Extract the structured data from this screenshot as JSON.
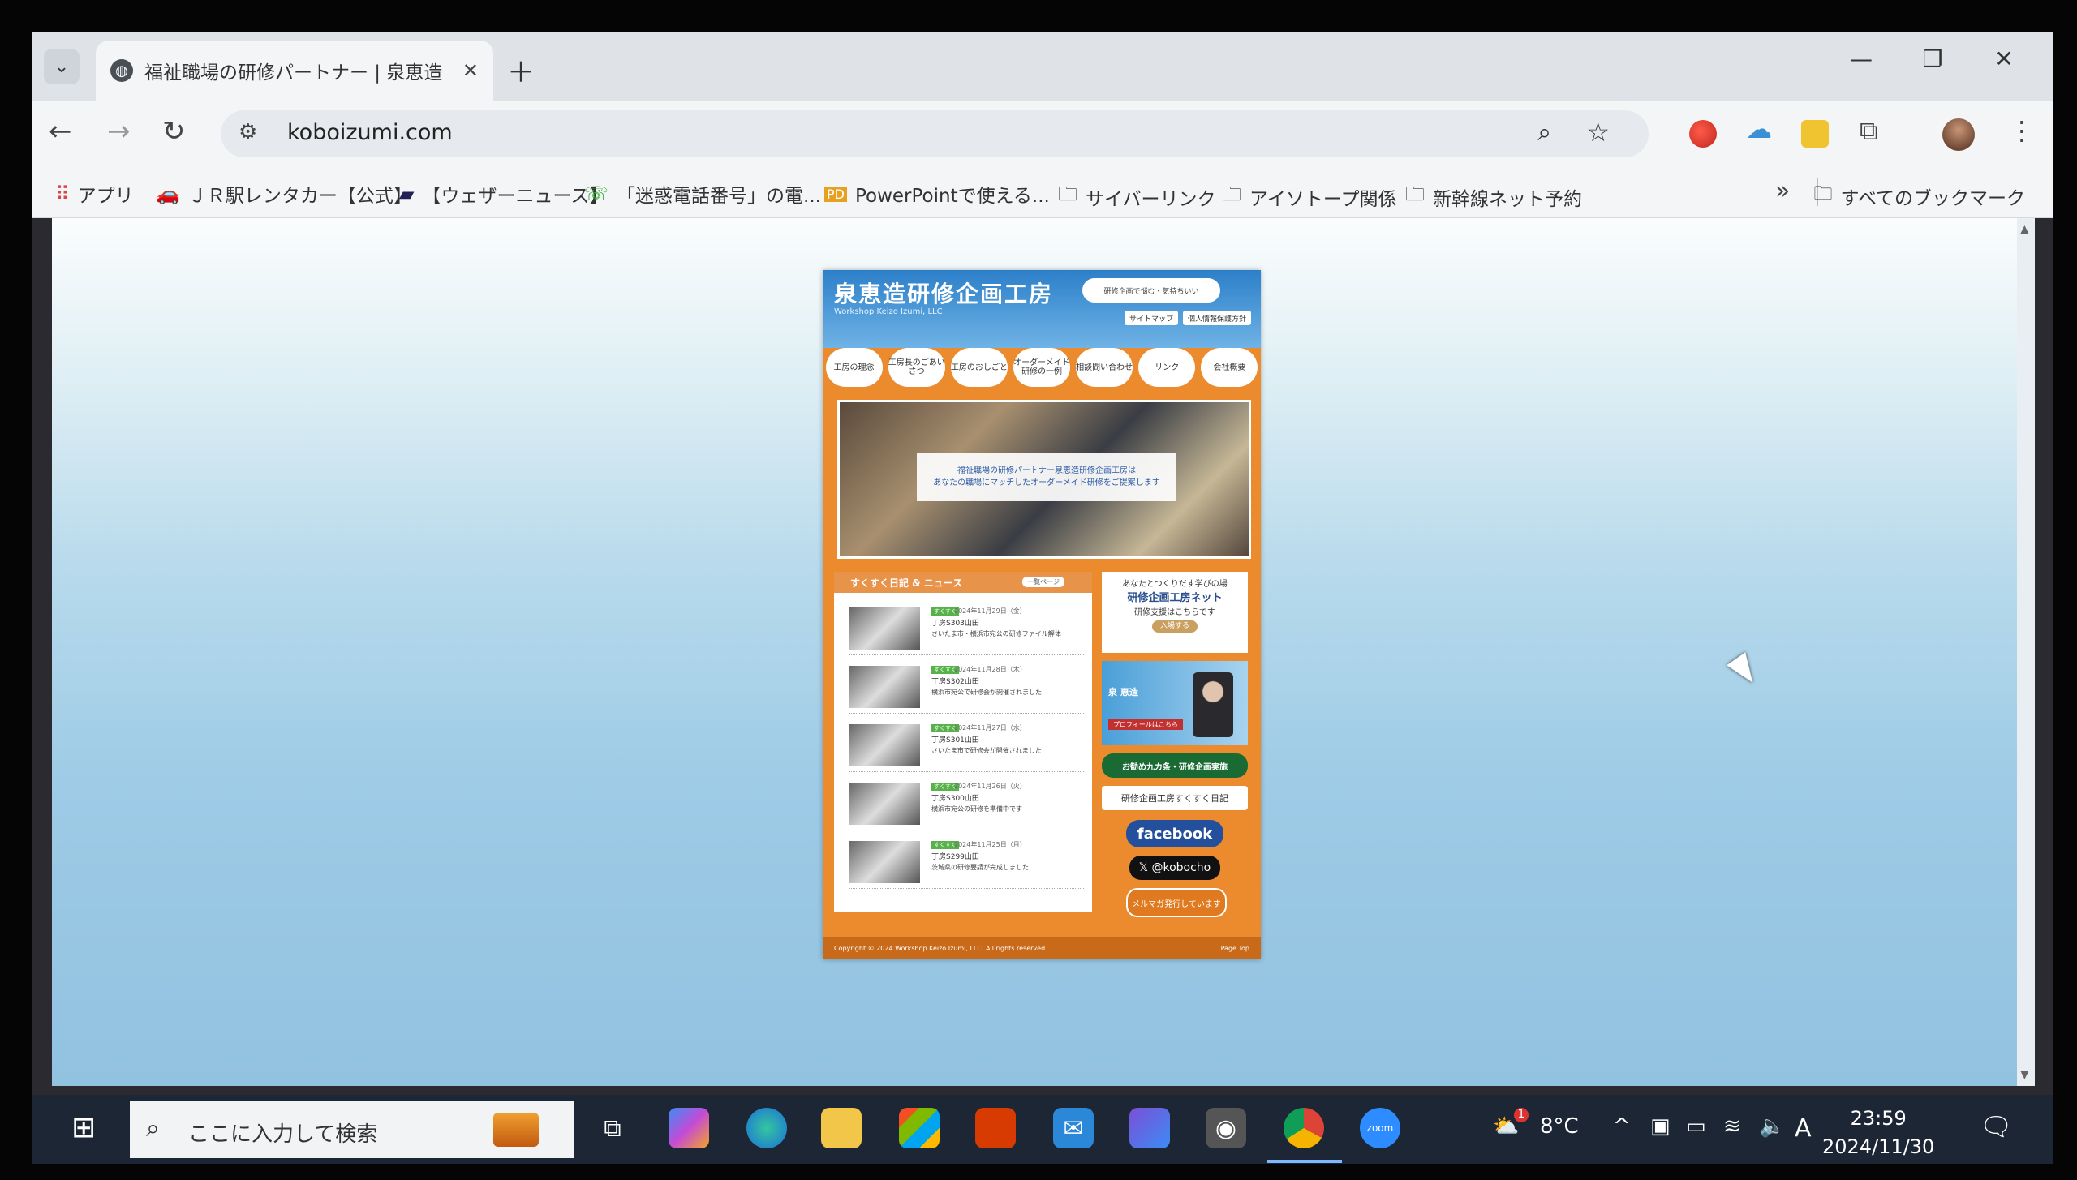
{
  "browser": {
    "tab_title": "福祉職場の研修パートナー | 泉恵造",
    "url": "koboizumi.com",
    "bookmarks": [
      {
        "label": "アプリ",
        "icon": "apps-grid-icon"
      },
      {
        "label": "ＪＲ駅レンタカー【公式】",
        "icon": "car-icon"
      },
      {
        "label": "【ウェザーニュース】",
        "icon": "weather-icon"
      },
      {
        "label": "「迷惑電話番号」の電...",
        "icon": "phone-search-icon"
      },
      {
        "label": "PowerPointで使える...",
        "icon": "pd-icon"
      },
      {
        "label": "サイバーリンク",
        "icon": "folder-icon"
      },
      {
        "label": "アイソトープ関係",
        "icon": "folder-icon"
      },
      {
        "label": "新幹線ネット予約",
        "icon": "folder-icon"
      }
    ],
    "all_bookmarks": "すべてのブックマーク"
  },
  "site": {
    "title": "泉恵造研修企画工房",
    "subtitle": "Workshop Keizo Izumi, LLC",
    "cloud_text": "研修企画で悩む・気持ちいい",
    "sitemap": "サイトマップ",
    "privacy": "個人情報保護方針",
    "nav": [
      "工房の理念",
      "工房長のごあいさつ",
      "工房のおしごと",
      "オーダーメイド研修の一例",
      "相談問い合わせ",
      "リンク",
      "会社概要"
    ],
    "hero_line1": "福祉職場の研修パートナー泉恵造研修企画工房は",
    "hero_line2": "あなたの職場にマッチしたオーダーメイド研修をご提案します",
    "news_title": "すくすく日記 & ニュース",
    "news_more": "一覧ページ",
    "news": [
      {
        "badge": "すくすく",
        "date": "2024年11月29日（金）",
        "name": "丁房S303山田",
        "desc": "さいたま市・横浜市宛公の研修ファイル解体"
      },
      {
        "badge": "すくすく",
        "date": "2024年11月28日（木）",
        "name": "丁房S302山田",
        "desc": "横浜市宛公で研修会が開催されました"
      },
      {
        "badge": "すくすく",
        "date": "2024年11月27日（水）",
        "name": "丁房S301山田",
        "desc": "さいたま市で研修会が開催されました"
      },
      {
        "badge": "すくすく",
        "date": "2024年11月26日（火）",
        "name": "丁房S300山田",
        "desc": "横浜市宛公の研修を準備中です"
      },
      {
        "badge": "すくすく",
        "date": "2024年11月25日（月）",
        "name": "丁房S299山田",
        "desc": "茨城県の研修要請が完成しました"
      }
    ],
    "net_line1": "あなたとつくりだす学びの場",
    "net_title": "研修企画工房ネット",
    "net_line2": "研修支援はこちらです",
    "net_join": "入場する",
    "profile_name": "泉 恵造",
    "profile_btn": "プロフィールはこちら",
    "green_banner": "お勧め九カ条・研修企画実施",
    "diary_banner": "研修企画工房すくすく日記",
    "facebook": "facebook",
    "x_handle": "𝕏 @kobocho",
    "mailmag": "メルマガ発行しています",
    "footer": "Copyright © 2024 Workshop Keizo Izumi, LLC. All rights reserved.",
    "page_top": "Page Top"
  },
  "taskbar": {
    "search_placeholder": "ここに入力して検索",
    "weather": "8°C",
    "weather_badge": "1",
    "ime": "A",
    "time": "23:59",
    "date": "2024/11/30"
  }
}
